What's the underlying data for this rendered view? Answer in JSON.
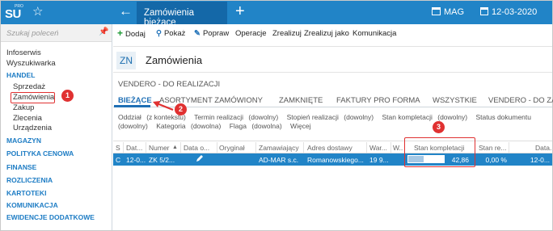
{
  "topbar": {
    "logo_text": "SU",
    "logo_sub": "PRO",
    "active_tab": "Zamówienia bieżące",
    "warehouse": "MAG",
    "date": "12-03-2020"
  },
  "sidebar": {
    "search_placeholder": "Szukaj poleceń",
    "items": [
      {
        "label": "Infoserwis",
        "kind": "plain"
      },
      {
        "label": "Wyszukiwarka",
        "kind": "plain"
      },
      {
        "label": "HANDEL",
        "kind": "head"
      },
      {
        "label": "Sprzedaż",
        "kind": "sub"
      },
      {
        "label": "Zamówienia",
        "kind": "sub-active"
      },
      {
        "label": "Zakup",
        "kind": "sub"
      },
      {
        "label": "Zlecenia",
        "kind": "sub"
      },
      {
        "label": "Urządzenia",
        "kind": "sub"
      },
      {
        "label": "MAGAZYN",
        "kind": "head"
      },
      {
        "label": "POLITYKA CENOWA",
        "kind": "head"
      },
      {
        "label": "FINANSE",
        "kind": "head"
      },
      {
        "label": "ROZLICZENIA",
        "kind": "head"
      },
      {
        "label": "KARTOTEKI",
        "kind": "head"
      },
      {
        "label": "KOMUNIKACJA",
        "kind": "head"
      },
      {
        "label": "EWIDENCJE DODATKOWE",
        "kind": "head"
      }
    ]
  },
  "toolbar": {
    "add": "Dodaj",
    "show": "Pokaż",
    "edit": "Popraw",
    "operations": "Operacje",
    "realize": "Zrealizuj",
    "realize_as": "Zrealizuj jako",
    "communication": "Komunikacja"
  },
  "main": {
    "code": "ZN",
    "title": "Zamówienia",
    "subtitle": "VENDERO - DO REALIZACJI",
    "tabs": [
      "BIEŻĄCE",
      "ASORTYMENT ZAMÓWIONY",
      "ZAMKNIĘTE",
      "FAKTURY PRO FORMA",
      "WSZYSTKIE",
      "VENDERO - DO ZA"
    ],
    "filters": [
      {
        "name": "Oddział",
        "value": "(z kontekstu)"
      },
      {
        "name": "Termin realizacji",
        "value": "(dowolny)"
      },
      {
        "name": "Stopień realizacji",
        "value": "(dowolny)"
      },
      {
        "name": "Stan kompletacji",
        "value": "(dowolny)"
      },
      {
        "name": "Status dokumentu",
        "value": "(dowolny)"
      },
      {
        "name": "Kategoria",
        "value": "(dowolna)"
      },
      {
        "name": "Flaga",
        "value": "(dowolna)"
      },
      {
        "name": "Więcej",
        "value": ""
      }
    ],
    "columns": [
      "S",
      "Dat...",
      "Numer",
      "Data o...",
      "Oryginał",
      "Zamawiający",
      "Adres dostawy",
      "War...",
      "W...",
      "Stan kompletacji",
      "Stan re...",
      "Data..."
    ],
    "row": {
      "s": "C",
      "date": "12-0...",
      "number": "ZK 5/2...",
      "customer": "AD-MAR s.c.",
      "address": "Romanowskiego...",
      "value": "19 9...",
      "completion": 42.86,
      "completion_label": "42,86 %",
      "realization": "0,00 %",
      "date2": "12-0..."
    }
  },
  "annotations": {
    "marker1": "1",
    "marker2": "2",
    "marker3": "3"
  },
  "colors": {
    "brand": "#2184c7",
    "accent": "#1f6fb5",
    "annotation": "#e03131"
  }
}
